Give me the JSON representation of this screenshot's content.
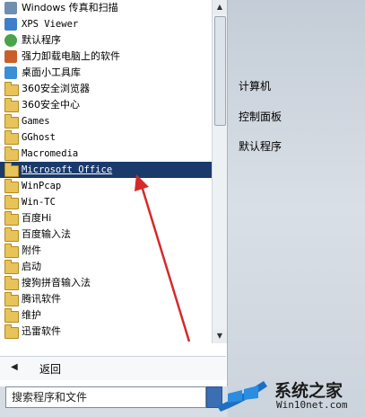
{
  "programs": [
    {
      "label": "Windows 传真和扫描",
      "icon": "fax-scan-icon",
      "mono": false
    },
    {
      "label": "XPS Viewer",
      "icon": "xps-viewer-icon",
      "mono": true
    },
    {
      "label": "默认程序",
      "icon": "default-programs-icon",
      "mono": false
    },
    {
      "label": "强力卸载电脑上的软件",
      "icon": "uninstaller-icon",
      "mono": false
    },
    {
      "label": "桌面小工具库",
      "icon": "gadgets-icon",
      "mono": false
    },
    {
      "label": "360安全浏览器",
      "icon": "folder-icon",
      "mono": false
    },
    {
      "label": "360安全中心",
      "icon": "folder-icon",
      "mono": false
    },
    {
      "label": "Games",
      "icon": "folder-icon",
      "mono": true
    },
    {
      "label": "GGhost",
      "icon": "folder-icon",
      "mono": true
    },
    {
      "label": "Macromedia",
      "icon": "folder-icon",
      "mono": true
    },
    {
      "label": "Microsoft Office",
      "icon": "folder-icon",
      "mono": true,
      "selected": true
    },
    {
      "label": "WinPcap",
      "icon": "folder-icon",
      "mono": true
    },
    {
      "label": "Win-TC",
      "icon": "folder-icon",
      "mono": true
    },
    {
      "label": "百度Hi",
      "icon": "folder-icon",
      "mono": false
    },
    {
      "label": "百度输入法",
      "icon": "folder-icon",
      "mono": false
    },
    {
      "label": "附件",
      "icon": "folder-icon",
      "mono": false
    },
    {
      "label": "启动",
      "icon": "folder-icon",
      "mono": false
    },
    {
      "label": "搜狗拼音输入法",
      "icon": "folder-icon",
      "mono": false
    },
    {
      "label": "腾讯软件",
      "icon": "folder-icon",
      "mono": false
    },
    {
      "label": "维护",
      "icon": "folder-icon",
      "mono": false
    },
    {
      "label": "迅雷软件",
      "icon": "folder-icon",
      "mono": false
    }
  ],
  "back": {
    "label": "返回"
  },
  "search": {
    "placeholder": "搜索程序和文件"
  },
  "right_menu": [
    {
      "label": "计算机"
    },
    {
      "label": "控制面板"
    },
    {
      "label": "默认程序"
    }
  ],
  "watermark": {
    "main": "系统之家",
    "sub": "Win10net.com"
  },
  "colors": {
    "selection": "#1a3a6b",
    "arrow": "#d42a2a",
    "folder": "#e8c35a"
  }
}
